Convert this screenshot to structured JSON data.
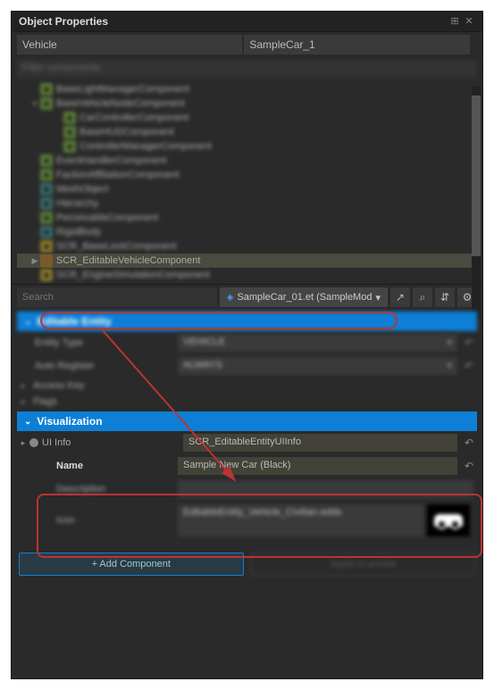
{
  "header": {
    "title": "Object Properties"
  },
  "entity": {
    "class": "Vehicle",
    "name": "SampleCar_1"
  },
  "filter": {
    "placeholder": "Filter components"
  },
  "tree": [
    {
      "indent": 14,
      "badge": "g",
      "label": "BaseLightManagerComponent",
      "blur": true
    },
    {
      "indent": 14,
      "badge": "g",
      "label": "BaseVehicleNodeComponent",
      "blur": true,
      "exp": "▾"
    },
    {
      "indent": 40,
      "badge": "g",
      "label": "CarControllerComponent",
      "blur": true
    },
    {
      "indent": 40,
      "badge": "g",
      "label": "BaseHUDComponent",
      "blur": true
    },
    {
      "indent": 40,
      "badge": "g",
      "label": "ControllerManagerComponent",
      "blur": true
    },
    {
      "indent": 14,
      "badge": "g",
      "label": "EventHandlerComponent",
      "blur": true
    },
    {
      "indent": 14,
      "badge": "g",
      "label": "FactionAffiliationComponent",
      "blur": true
    },
    {
      "indent": 14,
      "badge": "t",
      "label": "MeshObject",
      "blur": true
    },
    {
      "indent": 14,
      "badge": "t",
      "label": "Hierarchy",
      "blur": true
    },
    {
      "indent": 14,
      "badge": "g",
      "label": "PerceivableComponent",
      "blur": true
    },
    {
      "indent": 14,
      "badge": "t",
      "label": "RigidBody",
      "blur": true
    },
    {
      "indent": 14,
      "badge": "y",
      "label": "SCR_BaseLockComponent",
      "blur": true
    },
    {
      "indent": 14,
      "badge": "o",
      "label": "SCR_EditableVehicleComponent",
      "blur": false,
      "sel": true,
      "icon": "▶"
    },
    {
      "indent": 14,
      "badge": "y",
      "label": "SCR_EngineSimulationComponent",
      "blur": true
    }
  ],
  "search": {
    "placeholder": "Search",
    "asset": "SampleCar_01.et (SampleMod"
  },
  "sections": {
    "editable": {
      "title": "Editable Entity",
      "rows": [
        {
          "label": "Entity Type",
          "value": "VEHICLE",
          "dd": true
        },
        {
          "label": "Auto Register",
          "value": "ALWAYS",
          "dd": true
        },
        {
          "label": "Access Key",
          "exp": true
        },
        {
          "label": "Flags",
          "exp": true
        }
      ]
    },
    "viz": {
      "title": "Visualization",
      "uiinfo_label": "UI Info",
      "uiinfo_value": "SCR_EditableEntityUIInfo",
      "name_label": "Name",
      "name_value": "Sample New Car (Black)",
      "desc_label": "Description",
      "icon_label": "Icon",
      "icon_value": "EditableEntity_Vehicle_Civilian.edds"
    }
  },
  "buttons": {
    "add": "+ Add Component",
    "apply": "Apply to prefab"
  }
}
